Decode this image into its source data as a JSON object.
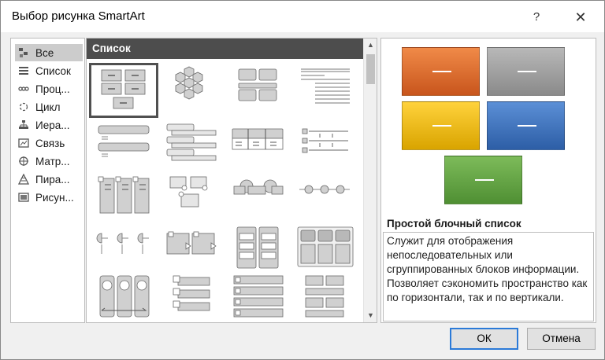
{
  "window": {
    "title": "Выбор рисунка SmartArt",
    "help_label": "?",
    "close_label": "✕"
  },
  "categories": [
    {
      "label": "Все",
      "icon": "all-icon",
      "selected": true
    },
    {
      "label": "Список",
      "icon": "list-icon"
    },
    {
      "label": "Проц...",
      "icon": "process-icon"
    },
    {
      "label": "Цикл",
      "icon": "cycle-icon"
    },
    {
      "label": "Иера...",
      "icon": "hierarchy-icon"
    },
    {
      "label": "Связь",
      "icon": "relationship-icon"
    },
    {
      "label": "Матр...",
      "icon": "matrix-icon"
    },
    {
      "label": "Пира...",
      "icon": "pyramid-icon"
    },
    {
      "label": "Рисун...",
      "icon": "picture-icon"
    }
  ],
  "gallery": {
    "header": "Список",
    "layouts": [
      "basic-block-list",
      "hexagon-cluster",
      "stacked-blocks",
      "lined-list",
      "vertical-bullet-list",
      "vertical-box-list",
      "horizontal-bullet-list",
      "table-list",
      "vertical-picture-list",
      "picture-caption-list",
      "circle-accent-timeline",
      "bullet-circle-list",
      "half-circle-accent",
      "arrow-box-process",
      "grouped-list",
      "picture-block-grid",
      "circular-picture-callout",
      "vertical-circle-list",
      "trapezoid-list",
      "block-grid-list"
    ]
  },
  "preview": {
    "title": "Простой блочный список",
    "description": "Служит для отображения непоследовательных или сгруппированных блоков информации. Позволяет сэкономить пространство как по горизонтали, так и по вертикали.",
    "colors": {
      "orange": "#e06c2a",
      "gray": "#9f9f9f",
      "yellow": "#f2bd0c",
      "blue": "#3e72c0",
      "green": "#62a342"
    }
  },
  "buttons": {
    "ok": "ОК",
    "cancel": "Отмена"
  }
}
